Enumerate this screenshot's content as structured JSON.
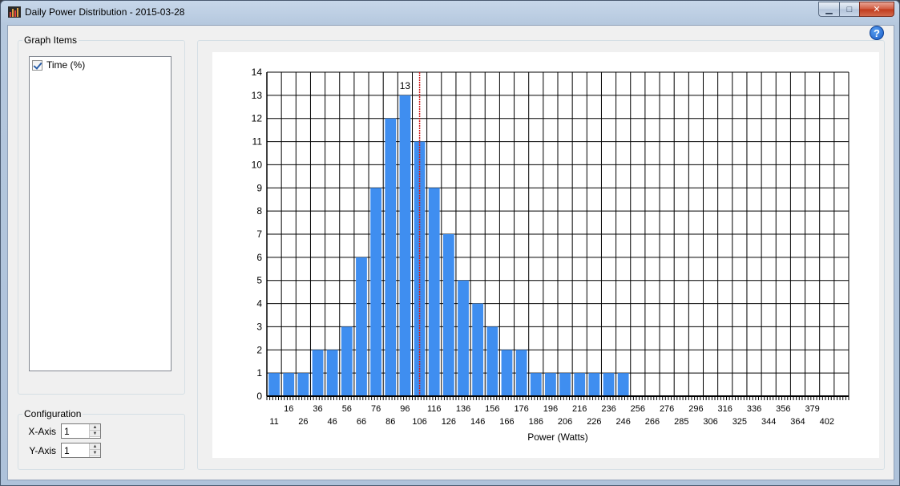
{
  "window": {
    "title": "Daily Power Distribution - 2015-03-28",
    "minimize_glyph": "▁",
    "maximize_glyph": "□",
    "close_glyph": "✕",
    "help_glyph": "?"
  },
  "graph_items": {
    "legend": "Graph Items",
    "items": [
      {
        "label": "Time (%)",
        "checked": true
      }
    ]
  },
  "configuration": {
    "legend": "Configuration",
    "x_axis_label": "X-Axis",
    "x_axis_value": "1",
    "y_axis_label": "Y-Axis",
    "y_axis_value": "1"
  },
  "chart_data": {
    "type": "bar",
    "xlabel": "Power (Watts)",
    "ylabel": "",
    "ylim": [
      0,
      14
    ],
    "yticks": [
      0,
      1,
      2,
      3,
      4,
      5,
      6,
      7,
      8,
      9,
      10,
      11,
      12,
      13,
      14
    ],
    "categories_top": [
      "16",
      "36",
      "56",
      "76",
      "96",
      "116",
      "136",
      "156",
      "176",
      "196",
      "216",
      "236",
      "256",
      "276",
      "296",
      "316",
      "336",
      "356",
      "379"
    ],
    "categories_bottom": [
      "11",
      "26",
      "46",
      "66",
      "86",
      "106",
      "126",
      "146",
      "166",
      "186",
      "206",
      "226",
      "246",
      "266",
      "285",
      "306",
      "325",
      "344",
      "364",
      "402"
    ],
    "values": [
      1,
      1,
      1,
      2,
      2,
      3,
      6,
      9,
      12,
      13,
      11,
      9,
      7,
      5,
      4,
      3,
      2,
      2,
      1,
      1,
      1,
      1,
      1,
      1,
      1,
      0,
      0,
      0,
      0,
      0,
      0,
      0,
      0,
      0,
      0,
      0,
      0,
      0,
      0,
      0
    ],
    "peak_label": "13",
    "marker_line_at_index": 10,
    "colors": {
      "bar": "#3f8ef0",
      "marker": "#d02020",
      "grid": "#000000"
    },
    "grid": true
  }
}
